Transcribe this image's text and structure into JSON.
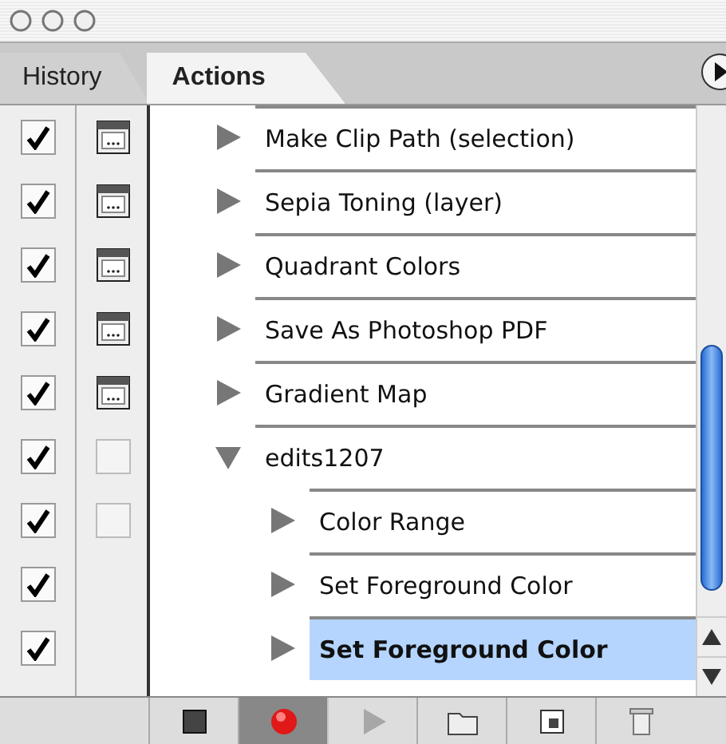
{
  "tabs": [
    {
      "label": "History",
      "selected": false
    },
    {
      "label": "Actions",
      "selected": true
    }
  ],
  "actions": [
    {
      "name": "Make Clip Path (selection)",
      "checked": true,
      "dialog": true,
      "expanded": false,
      "selected": false
    },
    {
      "name": "Sepia Toning (layer)",
      "checked": true,
      "dialog": true,
      "expanded": false,
      "selected": false
    },
    {
      "name": "Quadrant Colors",
      "checked": true,
      "dialog": true,
      "expanded": false,
      "selected": false
    },
    {
      "name": "Save As Photoshop PDF",
      "checked": true,
      "dialog": true,
      "expanded": false,
      "selected": false
    },
    {
      "name": "Gradient Map",
      "checked": true,
      "dialog": true,
      "expanded": false,
      "selected": false
    },
    {
      "name": "edits1207",
      "checked": true,
      "dialog": false,
      "expanded": true,
      "selected": false,
      "children": [
        {
          "name": "Color Range",
          "checked": true,
          "dialog": false,
          "expanded": false,
          "selected": false
        },
        {
          "name": "Set Foreground Color",
          "checked": true,
          "expanded": false,
          "selected": false
        },
        {
          "name": "Set Foreground Color",
          "checked": true,
          "expanded": false,
          "selected": true
        }
      ]
    }
  ],
  "toolbar": [
    {
      "kind": "stop",
      "selected": false,
      "disabled": false
    },
    {
      "kind": "record",
      "selected": true,
      "disabled": false
    },
    {
      "kind": "play",
      "selected": false,
      "disabled": true
    },
    {
      "kind": "folder",
      "selected": false,
      "disabled": false
    },
    {
      "kind": "new",
      "selected": false,
      "disabled": false
    },
    {
      "kind": "trash",
      "selected": false,
      "disabled": false
    }
  ]
}
